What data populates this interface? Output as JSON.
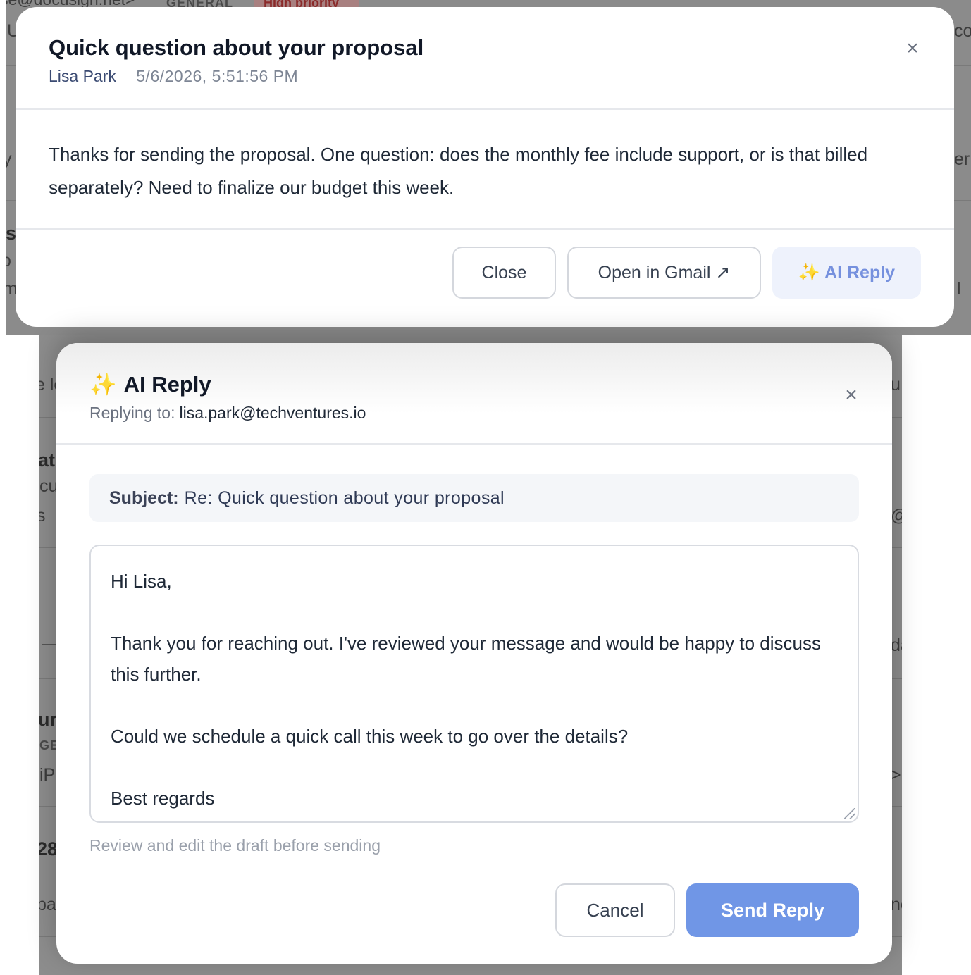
{
  "background": {
    "fragments": [
      "se@docusign.net>",
      "GENERAL",
      "High priority",
      "U",
      "co",
      "y",
      "er",
      "s",
      "o",
      "m",
      "l",
      "e lo",
      "u",
      "at",
      "cu",
      "s",
      "@s",
      "da",
      "ur",
      "GE",
      "iP",
      ">",
      "28",
      "pa",
      "ne"
    ]
  },
  "email_modal": {
    "title": "Quick question about your proposal",
    "sender": "Lisa Park",
    "date": "5/6/2026, 5:51:56 PM",
    "close_icon": "×",
    "body": "Thanks for sending the proposal. One question: does the monthly fee include support, or is that billed separately? Need to finalize our budget this week.",
    "close_label": "Close",
    "open_gmail_label": "Open in Gmail ↗",
    "ai_reply_icon": "✨",
    "ai_reply_label": "AI Reply"
  },
  "reply_modal": {
    "title_icon": "✨",
    "title": "AI Reply",
    "replying_label": "Replying to:",
    "replying_to": "lisa.park@techventures.io",
    "close_icon": "×",
    "subject_label": "Subject:",
    "subject_value": "Re: Quick question about your proposal",
    "draft": "Hi Lisa,\n\nThank you for reaching out. I've reviewed your message and would be happy to discuss this further.\n\nCould we schedule a quick call this week to go over the details?\n\nBest regards",
    "hint": "Review and edit the draft before sending",
    "cancel_label": "Cancel",
    "send_label": "Send Reply"
  },
  "colors": {
    "accent": "#7096e6",
    "ai_text": "#7691de",
    "ai_bg": "#eef2fc",
    "sparkle": "#f2c95a"
  }
}
